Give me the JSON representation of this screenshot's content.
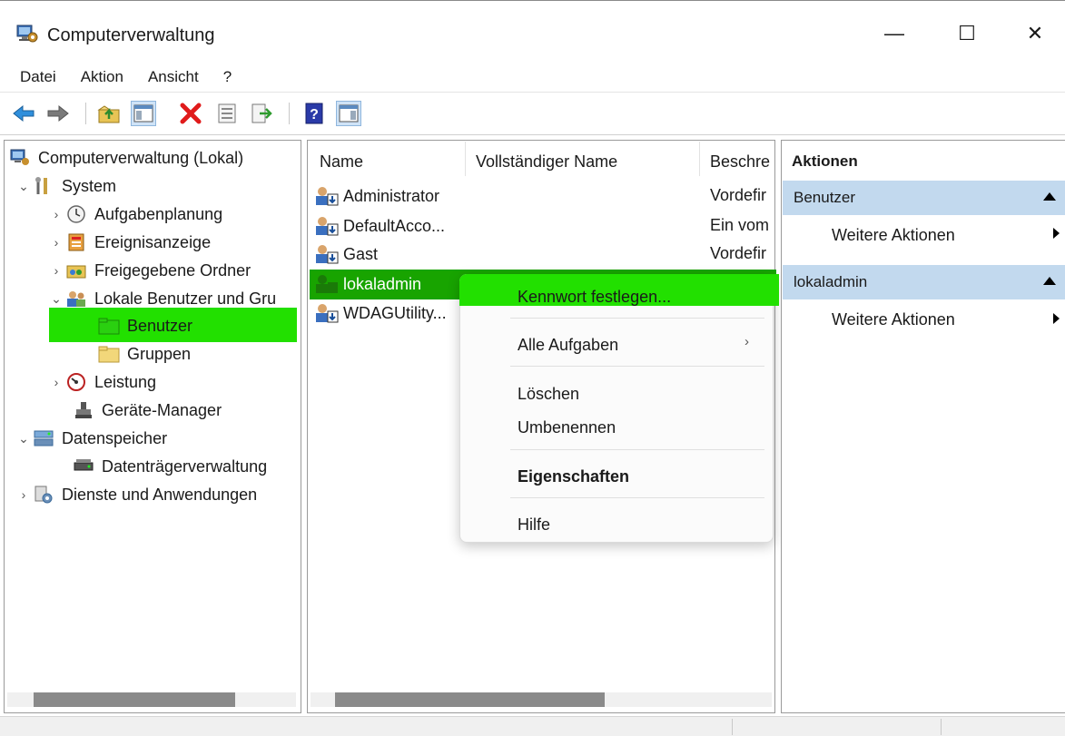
{
  "window": {
    "title": "Computerverwaltung",
    "controls": {
      "minimize": "—",
      "maximize": "☐",
      "close": "✕"
    }
  },
  "menu": [
    "Datei",
    "Aktion",
    "Ansicht",
    "?"
  ],
  "toolbar": {
    "buttons": [
      "back-icon",
      "forward-icon",
      "up-folder-icon",
      "show-hide-tree-icon",
      "delete-icon",
      "properties-icon",
      "export-list-icon",
      "help-icon",
      "show-hide-action-pane-icon"
    ]
  },
  "tree": {
    "root": "Computerverwaltung (Lokal)",
    "system": "System",
    "aufgaben": "Aufgabenplanung",
    "ereignis": "Ereignisanzeige",
    "freigabe": "Freigegebene Ordner",
    "lokale": "Lokale Benutzer und Gru",
    "benutzer": "Benutzer",
    "gruppen": "Gruppen",
    "leistung": "Leistung",
    "geraete": "Geräte-Manager",
    "datenspeicher": "Datenspeicher",
    "datentraeger": "Datenträgerverwaltung",
    "dienste": "Dienste und Anwendungen"
  },
  "list": {
    "columns": {
      "name": "Name",
      "fullname": "Vollständiger Name",
      "desc": "Beschre"
    },
    "rows": [
      {
        "name": "Administrator",
        "desc": "Vordefir"
      },
      {
        "name": "DefaultAcco...",
        "desc": "Ein vom"
      },
      {
        "name": "Gast",
        "desc": "Vordefir"
      },
      {
        "name": "lokaladmin",
        "desc": ""
      },
      {
        "name": "WDAGUtility...",
        "desc": ""
      }
    ]
  },
  "context_menu": {
    "set_password": "Kennwort festlegen...",
    "all_tasks": "Alle Aufgaben",
    "delete": "Löschen",
    "rename": "Umbenennen",
    "properties": "Eigenschaften",
    "help": "Hilfe",
    "submenu_arrow": "›"
  },
  "actions": {
    "header": "Aktionen",
    "section1": "Benutzer",
    "section1_more": "Weitere Aktionen",
    "section2": "lokaladmin",
    "section2_more": "Weitere Aktionen"
  },
  "colors": {
    "highlight_green": "#22e000",
    "selected_row_green": "#18a400",
    "actions_section_blue": "#c2d9ee"
  }
}
